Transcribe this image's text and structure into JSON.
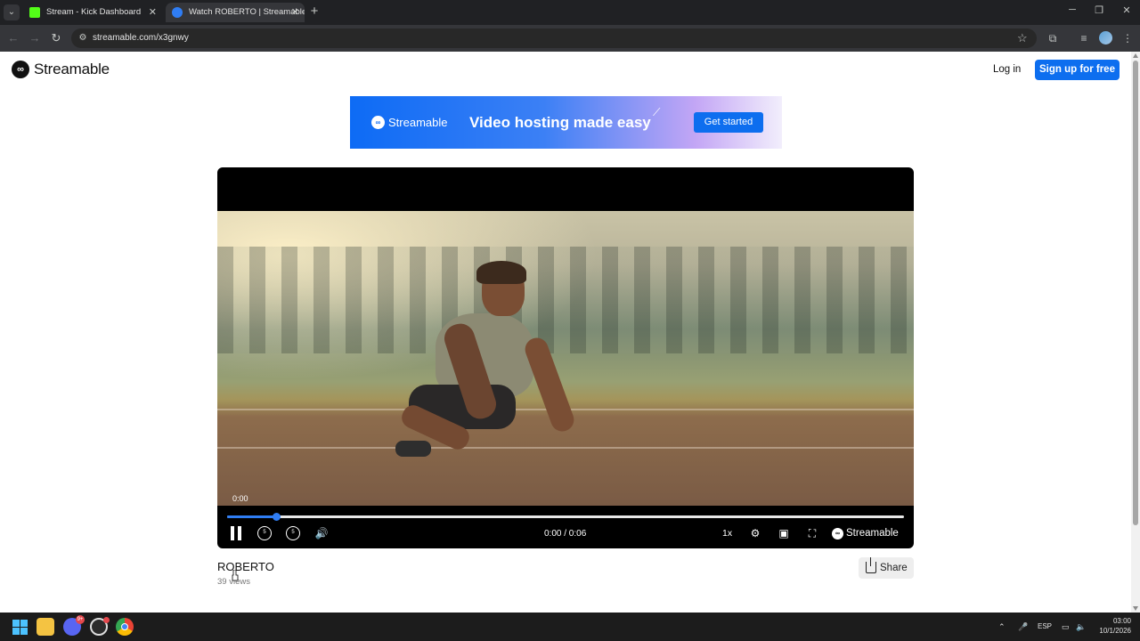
{
  "browser": {
    "tabs": [
      {
        "title": "Stream - Kick Dashboard",
        "favicon": "kick-icon",
        "active": false
      },
      {
        "title": "Watch ROBERTO | Streamable",
        "favicon": "streamable-icon",
        "active": true
      }
    ],
    "url": "streamable.com/x3gnwy"
  },
  "header": {
    "brand": "Streamable",
    "login_label": "Log in",
    "signup_label": "Sign up for free",
    "accent": "#0d6eef"
  },
  "banner": {
    "brand": "Streamable",
    "tagline": "Video hosting made easy",
    "cta_label": "Get started"
  },
  "player": {
    "current_time": "0:00",
    "timecode": "0:00 / 0:06",
    "speed": "1x",
    "brand": "Streamable",
    "progress_fraction": 0.072
  },
  "video": {
    "title": "ROBERTO",
    "views": "39 views",
    "share_label": "Share"
  },
  "taskbar": {
    "discord_badge": "9+",
    "language": "ESP",
    "time": "03:00",
    "date": "10/1/2026"
  }
}
